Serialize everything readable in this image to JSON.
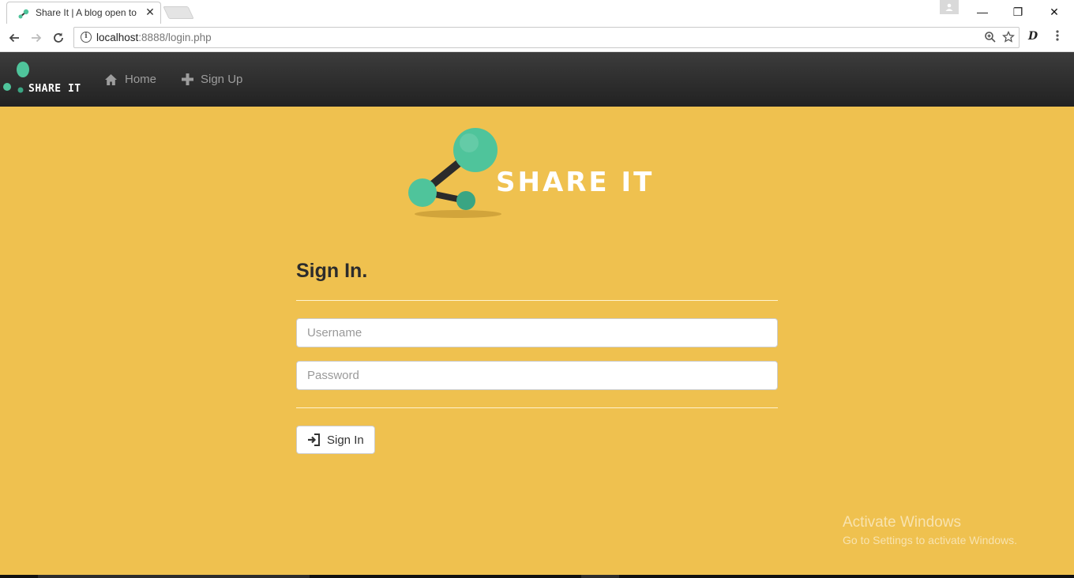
{
  "browser": {
    "tab_title": "Share It | A blog open to",
    "close_glyph": "✕",
    "url_host": "localhost",
    "url_path": ":8888/login.php",
    "window_controls": {
      "minimize": "—",
      "restore": "❐",
      "close": "✕"
    },
    "extension_label": "D"
  },
  "navbar": {
    "brand": "SHARE IT",
    "links": [
      {
        "label": "Home",
        "icon": "home-icon"
      },
      {
        "label": "Sign Up",
        "icon": "plus-icon"
      }
    ]
  },
  "hero": {
    "logo_text": "SHARE IT"
  },
  "form": {
    "title": "Sign In.",
    "username_placeholder": "Username",
    "password_placeholder": "Password",
    "submit_label": "Sign In"
  },
  "watermark": {
    "title": "Activate Windows",
    "subtitle": "Go to Settings to activate Windows."
  },
  "colors": {
    "page_background": "#efc14f",
    "navbar": "#2a2a2a",
    "brand_green": "#4fc49b"
  }
}
